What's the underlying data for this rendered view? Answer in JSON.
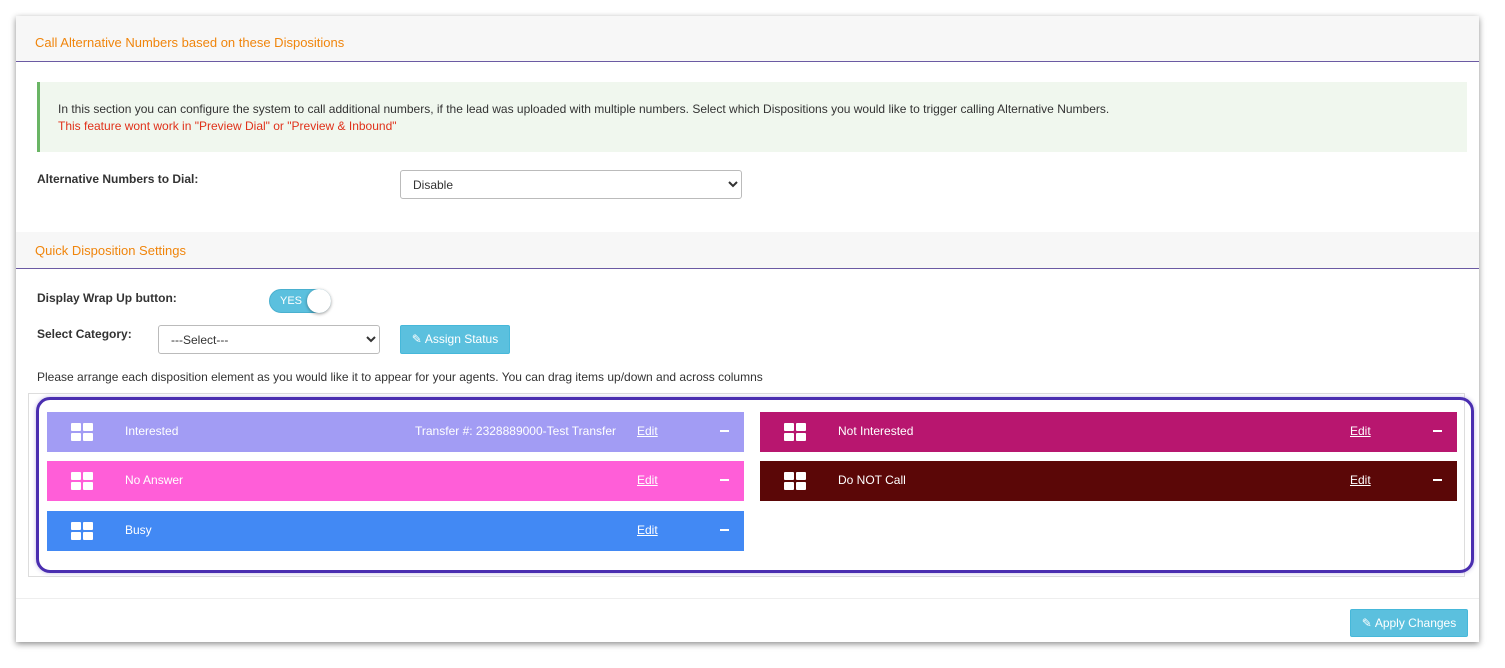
{
  "alt_section": {
    "title": "Call Alternative Numbers based on these Dispositions",
    "info_line1": "In this section you can configure the system to call additional numbers, if the lead was uploaded with multiple numbers. Select which Dispositions you would like to trigger calling Alternative Numbers.",
    "info_line2": "This feature wont work in \"Preview Dial\" or \"Preview & Inbound\"",
    "alt_label": "Alternative Numbers to Dial:",
    "alt_value": "Disable"
  },
  "quick_section": {
    "title": "Quick Disposition Settings",
    "wrapup_label": "Display Wrap Up button:",
    "wrapup_toggle": "YES",
    "category_label": "Select Category:",
    "category_value": "---Select---",
    "assign_button": "Assign Status",
    "arrange_note": "Please arrange each disposition element as you would like it to appear for your agents. You can drag items up/down and across columns"
  },
  "dispositions": {
    "left": [
      {
        "name": "Interested",
        "extra": "Transfer #: 2328889000-Test Transfer",
        "edit": "Edit",
        "color": "#a29cf4"
      },
      {
        "name": "No Answer",
        "extra": "",
        "edit": "Edit",
        "color": "#ff5ed8"
      },
      {
        "name": "Busy",
        "extra": "",
        "edit": "Edit",
        "color": "#4289f4"
      }
    ],
    "right": [
      {
        "name": "Not Interested",
        "extra": "",
        "edit": "Edit",
        "color": "#b8166f"
      },
      {
        "name": "Do NOT Call",
        "extra": "",
        "edit": "Edit",
        "color": "#5b0707"
      }
    ]
  },
  "footer": {
    "apply_button": "Apply Changes"
  },
  "colors": {
    "accent_orange": "#f0850c",
    "info_button": "#5bc0de",
    "highlight_border": "#4a2eb0"
  }
}
